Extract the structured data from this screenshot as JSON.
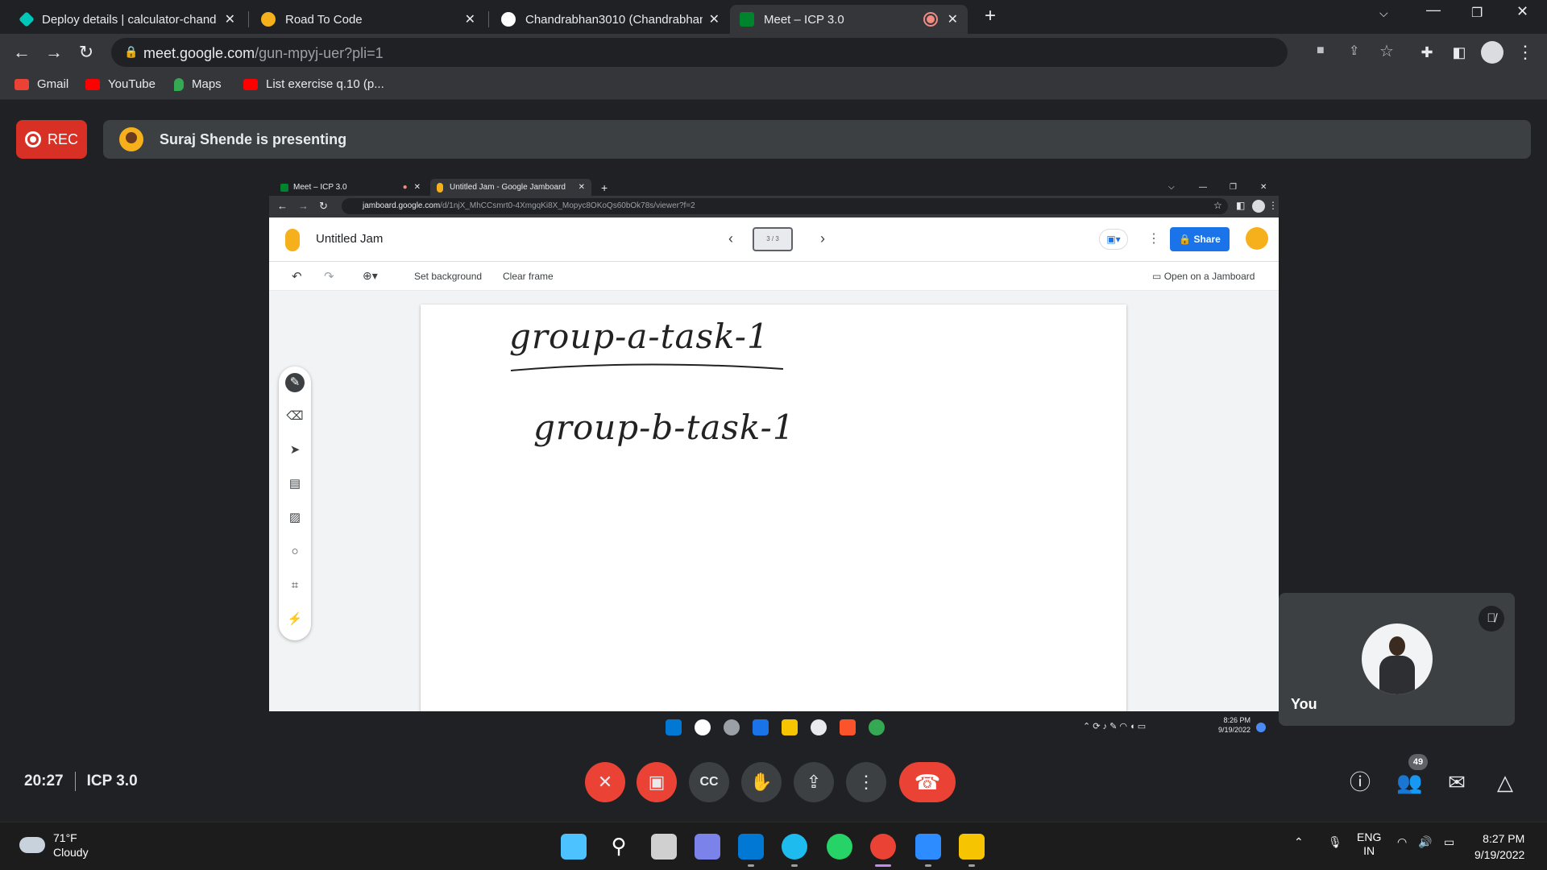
{
  "browser": {
    "tabs": [
      {
        "title": "Deploy details | calculator-chand",
        "favicon_color": "#00c7b7"
      },
      {
        "title": "Road To Code",
        "favicon_color": "#f6b01b"
      },
      {
        "title": "Chandrabhan3010 (Chandrabhan",
        "favicon_color": "#ffffff"
      },
      {
        "title": "Meet – ICP 3.0",
        "favicon_color": "#00832d",
        "active": true
      }
    ],
    "new_tab": "+",
    "address": {
      "host": "meet.google.com",
      "path": "/gun-mpyj-uer?pli=1"
    },
    "bookmarks": [
      {
        "label": "Gmail",
        "color": "#ea4335"
      },
      {
        "label": "YouTube",
        "color": "#ff0000"
      },
      {
        "label": "Maps",
        "color": "#34a853"
      },
      {
        "label": "List exercise q.10 (p...",
        "color": "#ff0000"
      }
    ]
  },
  "meet": {
    "rec_label": "REC",
    "presenting": "Suraj Shende is presenting",
    "time": "20:27",
    "meeting_name": "ICP 3.0",
    "self_label": "You",
    "people_count": "49"
  },
  "shared_screen": {
    "tabs": [
      {
        "title": "Meet – ICP 3.0"
      },
      {
        "title": "Untitled Jam - Google Jamboard"
      }
    ],
    "address": {
      "host": "jamboard.google.com",
      "path": "/d/1njX_MhCCsmrt0-4XmgqKi8X_Mopyc8OKoQs60bOk78s/viewer?f=2"
    },
    "jam_title": "Untitled Jam",
    "frame_indicator": "3 / 3",
    "share_label": "Share",
    "toolbar": {
      "set_background": "Set background",
      "clear_frame": "Clear frame",
      "open_on_jamboard": "Open on a Jamboard"
    },
    "canvas_text": [
      "group-a-task-1",
      "group-b-task-1"
    ],
    "taskbar_time": "8:26 PM",
    "taskbar_date": "9/19/2022"
  },
  "taskbar": {
    "weather_temp": "71°F",
    "weather_desc": "Cloudy",
    "lang_top": "ENG",
    "lang_bottom": "IN",
    "time": "8:27 PM",
    "date": "9/19/2022"
  }
}
